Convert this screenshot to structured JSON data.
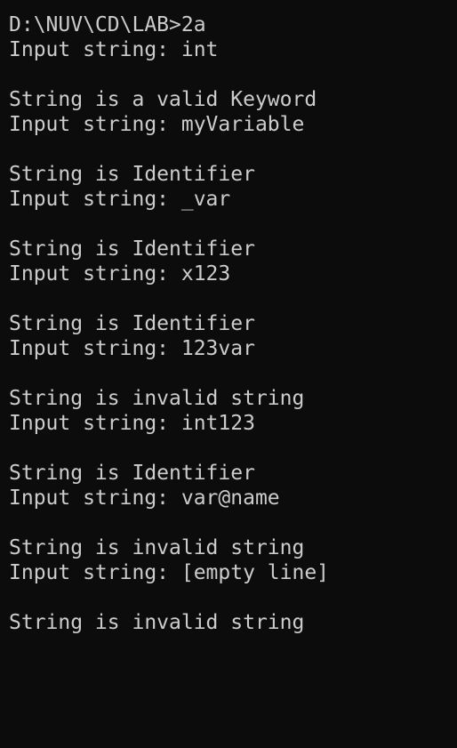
{
  "terminal": {
    "lines": [
      "D:\\NUV\\CD\\LAB>2a",
      "Input string: int",
      "",
      "String is a valid Keyword",
      "Input string: myVariable",
      "",
      "String is Identifier",
      "Input string: _var",
      "",
      "String is Identifier",
      "Input string: x123",
      "",
      "String is Identifier",
      "Input string: 123var",
      "",
      "String is invalid string",
      "Input string: int123",
      "",
      "String is Identifier",
      "Input string: var@name",
      "",
      "String is invalid string",
      "Input string: [empty line]",
      "",
      "String is invalid string"
    ]
  },
  "colors": {
    "background": "#0c0c0c",
    "text": "#cccccc"
  }
}
